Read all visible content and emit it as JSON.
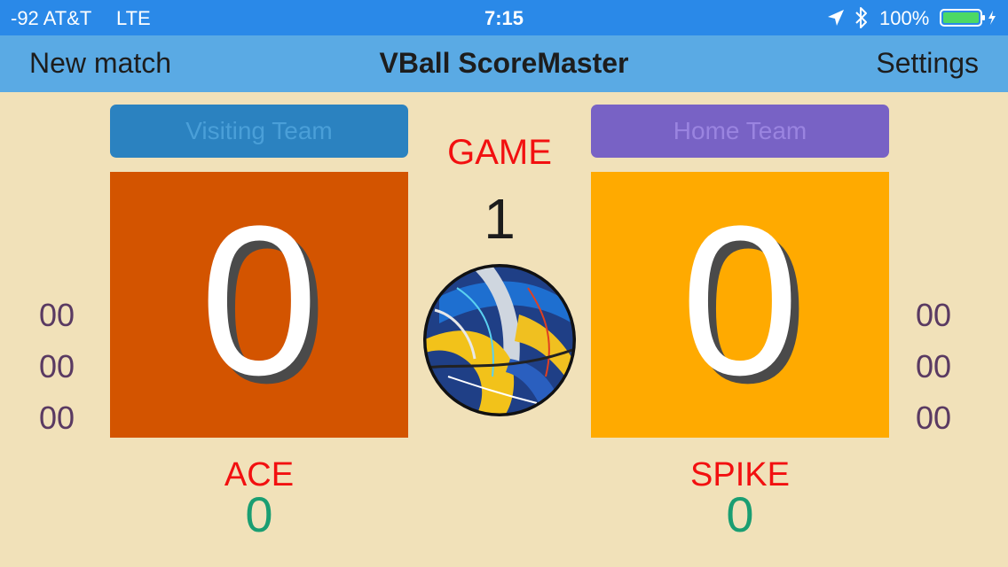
{
  "status_bar": {
    "carrier": "-92 AT&T",
    "network": "LTE",
    "time": "7:15",
    "battery": "100%",
    "icons": [
      "location-arrow-icon",
      "bluetooth-icon",
      "battery-charging-icon"
    ]
  },
  "nav": {
    "left_button": "New match",
    "title": "VBall ScoreMaster",
    "right_button": "Settings"
  },
  "teams": {
    "visiting": {
      "name": "Visiting Team",
      "score": "0",
      "color": "#d35400",
      "button_color": "#2b82c0"
    },
    "home": {
      "name": "Home Team",
      "score": "0",
      "color": "#ffaa00",
      "button_color": "#7862c5"
    }
  },
  "game": {
    "label": "GAME",
    "number": "1"
  },
  "set_scores": {
    "visiting": [
      "00",
      "00",
      "00"
    ],
    "home": [
      "00",
      "00",
      "00"
    ]
  },
  "stats": {
    "visiting": {
      "label": "ACE",
      "value": "0"
    },
    "home": {
      "label": "SPIKE",
      "value": "0"
    }
  },
  "colors": {
    "background": "#f1e1b9",
    "status_bar": "#2a89e8",
    "nav_bar": "#5aaae4",
    "accent_red": "#f21010",
    "stat_green": "#1a9e72",
    "set_score": "#5a3a62"
  }
}
